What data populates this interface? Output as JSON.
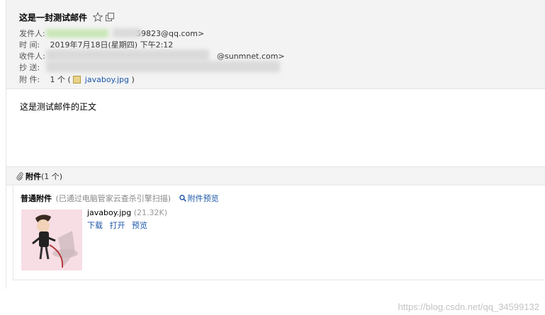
{
  "mail": {
    "subject": "这是一封测试邮件",
    "from_label": "发件人:",
    "from_partial": "59823@qq.com>",
    "time_label": "时  间:",
    "time_value": "2019年7月18日(星期四) 下午2:12",
    "to_label": "收件人:",
    "to_partial": "@sunmnet.com>",
    "cc_label": "抄  送:",
    "attach_label": "附  件:",
    "attach_summary_prefix": "1 个 (",
    "attach_chip_name": "javaboy.jpg",
    "attach_summary_suffix": ")",
    "body": "这是测试邮件的正文"
  },
  "attachments": {
    "title": "附件",
    "count": "(1 个)",
    "scan_title": "普通附件",
    "scan_note": "(已通过电脑管家云查杀引擎扫描)",
    "preview_label": "附件预览",
    "file_name": "javaboy.jpg",
    "file_size": "(21.32K)",
    "actions": {
      "download": "下载",
      "open": "打开",
      "preview": "预览"
    }
  },
  "watermark": "https://blog.csdn.net/qq_34599132",
  "icons": [
    "star-icon",
    "popout-icon",
    "paperclip-icon",
    "magnifier-icon",
    "image-file-icon"
  ],
  "colors": {
    "link": "#1a56a8",
    "header_bg": "#f3f3f3",
    "thumb_bg": "#f7dde4"
  }
}
